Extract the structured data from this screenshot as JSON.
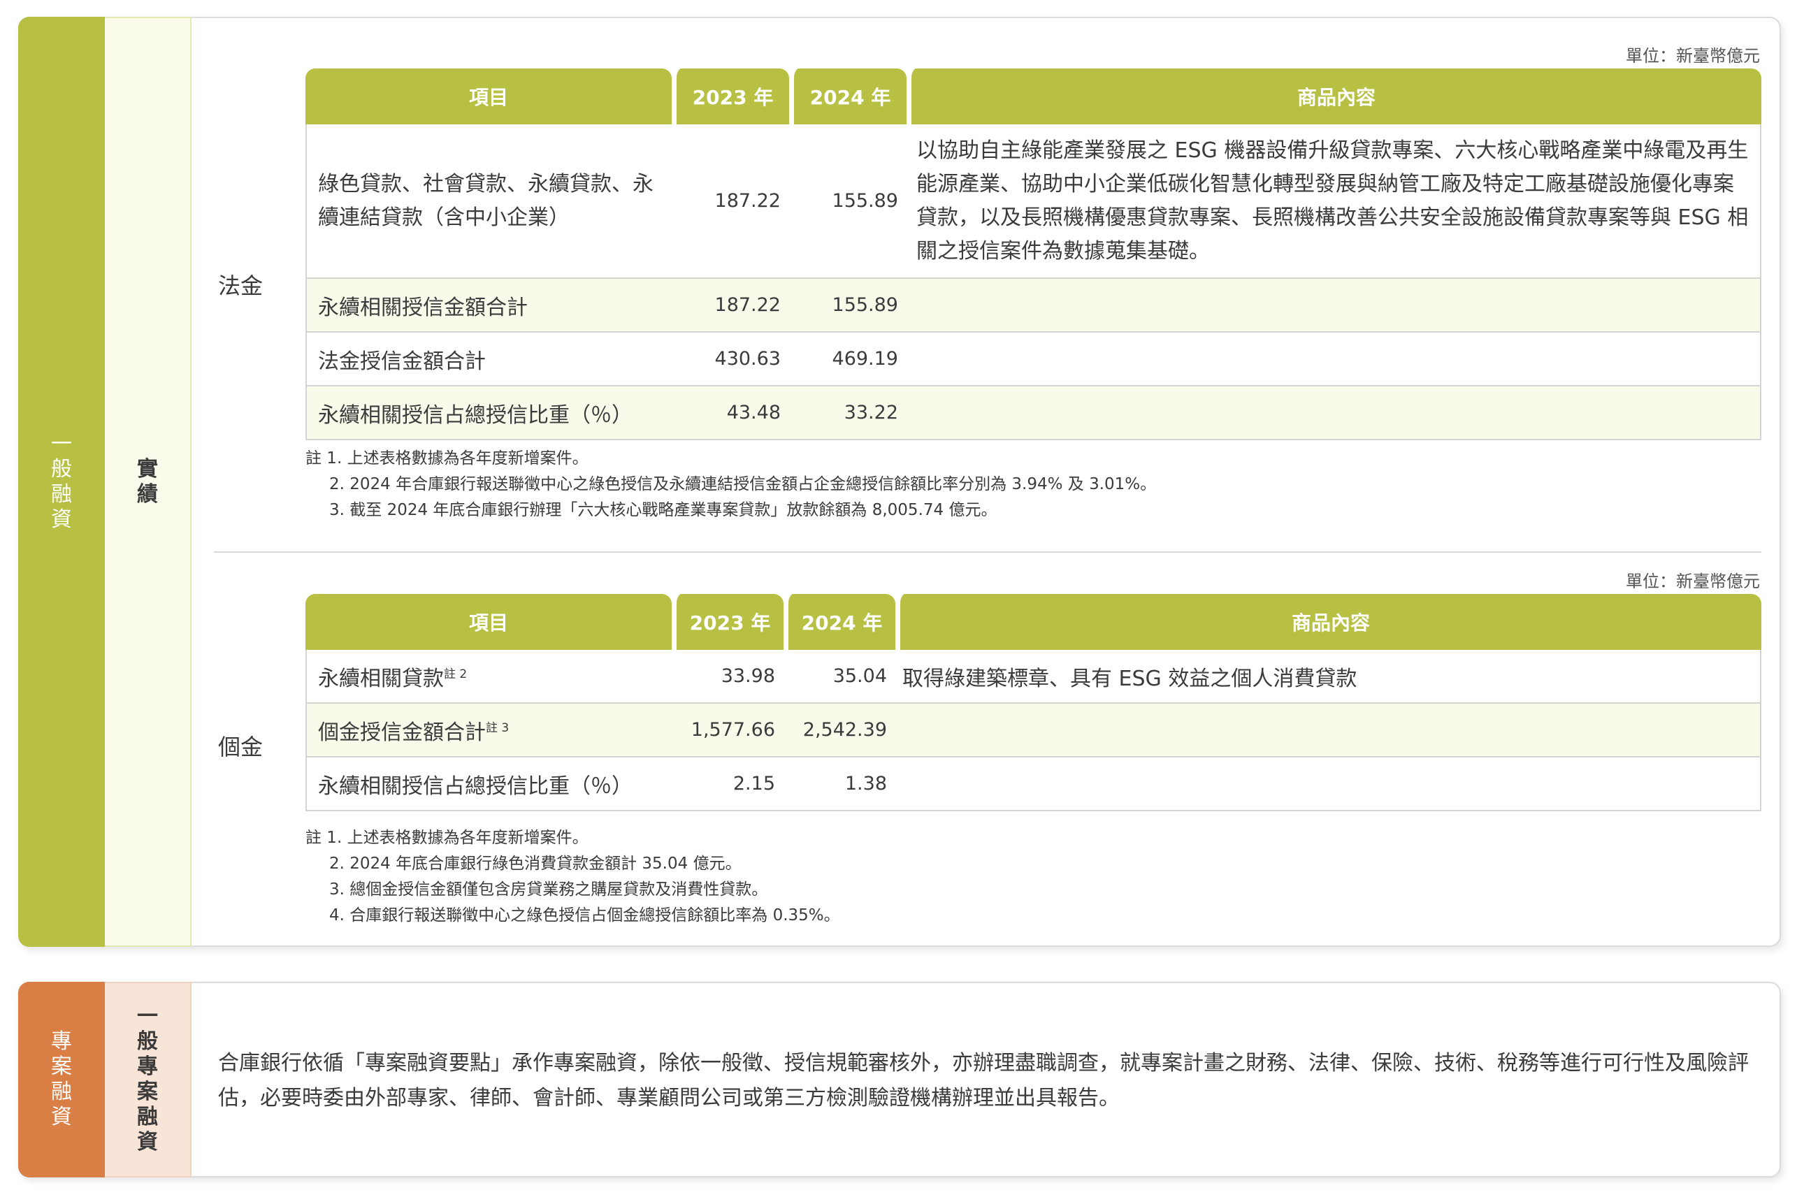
{
  "general": {
    "tab_main": [
      "一",
      "般",
      "融",
      "資"
    ],
    "tab_sub": [
      "實",
      "績"
    ],
    "corporate": {
      "label": "法金",
      "unit": "單位：新臺幣億元",
      "headers": [
        "項目",
        "2023 年",
        "2024 年",
        "商品內容"
      ],
      "rows": [
        {
          "item": "綠色貸款、社會貸款、永續貸款、永續連結貸款（含中小企業）",
          "y2023": "187.22",
          "y2024": "155.89",
          "content": "以協助自主綠能產業發展之 ESG 機器設備升級貸款專案、六大核心戰略產業中綠電及再生能源產業、協助中小企業低碳化智慧化轉型發展與納管工廠及特定工廠基礎設施優化專案貸款，以及長照機構優惠貸款專案、長照機構改善公共安全設施設備貸款專案等與 ESG 相關之授信案件為數據蒐集基礎。"
        },
        {
          "item": "永續相關授信金額合計",
          "y2023": "187.22",
          "y2024": "155.89",
          "content": ""
        },
        {
          "item": "法金授信金額合計",
          "y2023": "430.63",
          "y2024": "469.19",
          "content": ""
        },
        {
          "item": "永續相關授信占總授信比重（％）",
          "y2023": "43.48",
          "y2024": "33.22",
          "content": ""
        }
      ],
      "notes": [
        "註 1. 上述表格數據為各年度新增案件。",
        "2. 2024 年合庫銀行報送聯徵中心之綠色授信及永續連結授信金額占企金總授信餘額比率分別為 3.94% 及 3.01%。",
        "3. 截至 2024 年底合庫銀行辦理「六大核心戰略產業專案貸款」放款餘額為 8,005.74 億元。"
      ]
    },
    "personal": {
      "label": "個金",
      "unit": "單位：新臺幣億元",
      "headers": [
        "項目",
        "2023 年",
        "2024 年",
        "商品內容"
      ],
      "rows": [
        {
          "item": "永續相關貸款",
          "sup": "註 2",
          "y2023": "33.98",
          "y2024": "35.04",
          "content": "取得綠建築標章、具有 ESG 效益之個人消費貸款"
        },
        {
          "item": "個金授信金額合計",
          "sup": "註 3",
          "y2023": "1,577.66",
          "y2024": "2,542.39",
          "content": ""
        },
        {
          "item": "永續相關授信占總授信比重（％）",
          "sup": "",
          "y2023": "2.15",
          "y2024": "1.38",
          "content": ""
        }
      ],
      "notes": [
        "註 1. 上述表格數據為各年度新增案件。",
        "2. 2024 年底合庫銀行綠色消費貸款金額計 35.04 億元。",
        "3. 總個金授信金額僅包含房貸業務之購屋貸款及消費性貸款。",
        "4. 合庫銀行報送聯徵中心之綠色授信占個金總授信餘額比率為 0.35%。"
      ]
    }
  },
  "project": {
    "tab_main": [
      "專",
      "案",
      "融",
      "資"
    ],
    "tab_sub": [
      "一",
      "般",
      "專",
      "案",
      "融",
      "資"
    ],
    "text": "合庫銀行依循「專案融資要點」承作專案融資，除依一般徵、授信規範審核外，亦辦理盡職調查，就專案計畫之財務、法律、保險、技術、稅務等進行可行性及風險評估，必要時委由外部專家、律師、會計師、專業顧問公司或第三方檢測驗證機構辦理並出具報告。"
  },
  "colors": {
    "accent_green": "#b8c043",
    "accent_orange": "#d97f45",
    "row_shade": "#fafaeb"
  },
  "chart_data": [
    {
      "type": "table",
      "title": "法金",
      "columns": [
        "項目",
        "2023 年",
        "2024 年",
        "商品內容"
      ],
      "rows": [
        [
          "綠色貸款、社會貸款、永續貸款、永續連結貸款（含中小企業）",
          187.22,
          155.89
        ],
        [
          "永續相關授信金額合計",
          187.22,
          155.89
        ],
        [
          "法金授信金額合計",
          430.63,
          469.19
        ],
        [
          "永續相關授信占總授信比重（％）",
          43.48,
          33.22
        ]
      ]
    },
    {
      "type": "table",
      "title": "個金",
      "columns": [
        "項目",
        "2023 年",
        "2024 年",
        "商品內容"
      ],
      "rows": [
        [
          "永續相關貸款",
          33.98,
          35.04
        ],
        [
          "個金授信金額合計",
          1577.66,
          2542.39
        ],
        [
          "永續相關授信占總授信比重（％）",
          2.15,
          1.38
        ]
      ]
    }
  ]
}
